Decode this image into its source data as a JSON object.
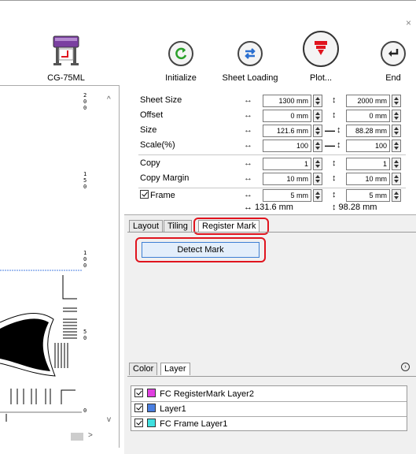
{
  "window": {
    "close_glyph": "×"
  },
  "toolbar": {
    "device_label": "CG-75ML",
    "initialize_label": "Initialize",
    "sheet_loading_label": "Sheet Loading",
    "plot_label": "Plot...",
    "end_label": "End"
  },
  "preview": {
    "ruler_labels": [
      "2\n0\n0",
      "1\n5\n0",
      "1\n0\n0",
      "5\n0",
      "0"
    ]
  },
  "properties": {
    "sheet_size": {
      "label": "Sheet Size",
      "h": "1300 mm",
      "v": "2000 mm"
    },
    "offset": {
      "label": "Offset",
      "h": "0 mm",
      "v": "0 mm"
    },
    "size": {
      "label": "Size",
      "h": "121.6 mm",
      "v": "88.28 mm"
    },
    "scale": {
      "label": "Scale(%)",
      "h": "100",
      "v": "100"
    },
    "copy": {
      "label": "Copy",
      "h": "1",
      "v": "1"
    },
    "copy_margin": {
      "label": "Copy Margin",
      "h": "10 mm",
      "v": "10 mm"
    },
    "frame": {
      "label": "Frame",
      "h": "5 mm",
      "v": "5 mm",
      "checked": true
    },
    "total": {
      "h": "↔ 131.6 mm",
      "v": "↕ 98.28 mm"
    },
    "h_arrow": "↔",
    "v_arrow": "↕",
    "link_dash": "—"
  },
  "tabs": {
    "layout": "Layout",
    "tiling": "Tiling",
    "register_mark": "Register Mark",
    "active": "Register Mark"
  },
  "register_mark": {
    "detect_button": "Detect Mark"
  },
  "layer_tabs": {
    "color": "Color",
    "layer": "Layer",
    "active": "Layer"
  },
  "layers": [
    {
      "name": "FC RegisterMark Layer2",
      "color": "#e040e0",
      "checked": true
    },
    {
      "name": "Layer1",
      "color": "#4a7fe0",
      "checked": true
    },
    {
      "name": "FC Frame Layer1",
      "color": "#40e0e0",
      "checked": true
    }
  ],
  "colors": {
    "highlight": "#e0141e",
    "accent": "#3c7fd4"
  }
}
